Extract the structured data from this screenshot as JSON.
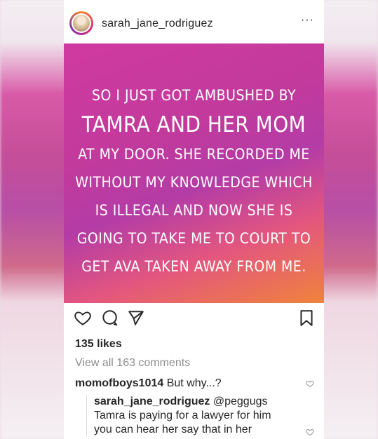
{
  "header": {
    "username": "sarah_jane_rodriguez",
    "more_label": "···"
  },
  "post": {
    "lines": [
      "SO I JUST GOT AMBUSHED BY",
      "TAMRA AND HER MOM",
      "AT MY DOOR. SHE RECORDED ME",
      "WITHOUT MY KNOWLEDGE WHICH",
      "IS ILLEGAL AND NOW SHE IS",
      "GOING TO TAKE ME TO COURT TO",
      "GET AVA TAKEN AWAY FROM ME."
    ]
  },
  "actions": {
    "icons": [
      "heart-icon",
      "comment-icon",
      "share-icon",
      "bookmark-icon"
    ]
  },
  "likes": "135 likes",
  "view_all": "View all 163 comments",
  "comments": [
    {
      "user": "momofboys1014",
      "text": "But why...?"
    }
  ],
  "reply": {
    "user": "sarah_jane_rodriguez",
    "mention": "@peggugs",
    "line1": "Tamra is paying for a lawyer for him",
    "line2": "you can hear her say that in her"
  },
  "colors": {
    "gradient_start": "#d03aa0",
    "gradient_end": "#f0833b",
    "text_primary": "#262626",
    "text_secondary": "#8e8e8e"
  }
}
